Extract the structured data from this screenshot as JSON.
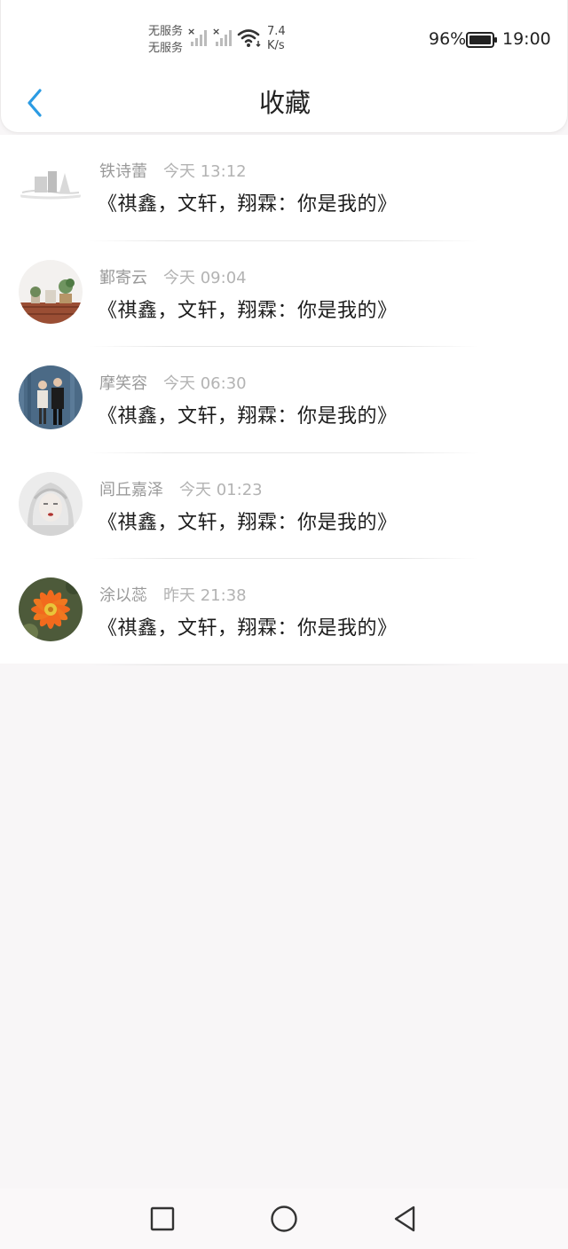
{
  "status_bar": {
    "service_line1": "无服务",
    "service_line2": "无服务",
    "speed_value": "7.4",
    "speed_unit": "K/s",
    "battery_percent": "96%",
    "time": "19:00"
  },
  "header": {
    "title": "收藏",
    "back_icon": "chevron-left-icon",
    "accent_color": "#2b9be3"
  },
  "favorites": [
    {
      "name": "铁诗蕾",
      "time": "今天 13:12",
      "text": "《祺鑫，文轩，翔霖：你是我的》",
      "avatar": "sketch-landscape"
    },
    {
      "name": "鄞寄云",
      "time": "今天 09:04",
      "text": "《祺鑫，文轩，翔霖：你是我的》",
      "avatar": "potted-plants-shelf"
    },
    {
      "name": "摩笑容",
      "time": "今天 06:30",
      "text": "《祺鑫，文轩，翔霖：你是我的》",
      "avatar": "couple-photo"
    },
    {
      "name": "闾丘嘉泽",
      "time": "今天 01:23",
      "text": "《祺鑫，文轩，翔霖：你是我的》",
      "avatar": "white-hair-portrait"
    },
    {
      "name": "涂以蕊",
      "time": "昨天 21:38",
      "text": "《祺鑫，文轩，翔霖：你是我的》",
      "avatar": "orange-cactus-flower"
    }
  ],
  "nav_bar": {
    "recent_icon": "square-icon",
    "home_icon": "circle-icon",
    "back_icon": "triangle-back-icon"
  }
}
